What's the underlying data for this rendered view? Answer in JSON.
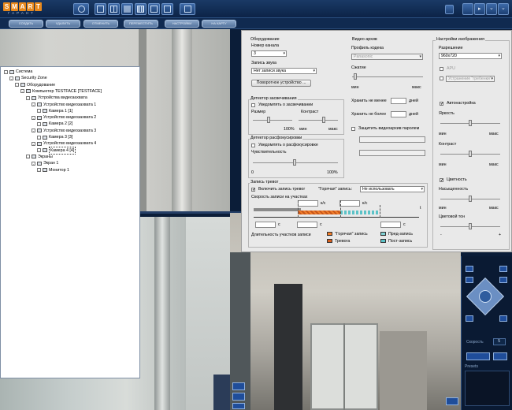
{
  "logo": {
    "word": "SMART",
    "sub": "ГАРАНТ"
  },
  "commands": [
    "создать",
    "удалить",
    "отменить",
    "переместить",
    "настройки",
    "на карту"
  ],
  "tree": {
    "items": [
      {
        "label": "Система",
        "level": 0,
        "icon": "system-icon"
      },
      {
        "label": "Security Zone",
        "level": 1,
        "icon": "zone-icon"
      },
      {
        "label": "Оборудование",
        "level": 2,
        "icon": "folder-icon"
      },
      {
        "label": "Компьютер TESTFACE [TESTFACE]",
        "level": 3,
        "icon": "computer-icon"
      },
      {
        "label": "Устройства видеозахвата",
        "level": 4,
        "icon": "folder-icon"
      },
      {
        "label": "Устройство видеозахвата 1",
        "level": 5,
        "icon": "capture-device-icon"
      },
      {
        "label": "Камера 1 [1]",
        "level": 6,
        "icon": "camera-icon"
      },
      {
        "label": "Устройство видеозахвата 2",
        "level": 5,
        "icon": "capture-device-icon"
      },
      {
        "label": "Камера 2 [2]",
        "level": 6,
        "icon": "camera-icon"
      },
      {
        "label": "Устройство видеозахвата 3",
        "level": 5,
        "icon": "capture-device-icon"
      },
      {
        "label": "Камера 3 [3]",
        "level": 6,
        "icon": "camera-icon"
      },
      {
        "label": "Устройство видеозахвата 4",
        "level": 5,
        "icon": "capture-device-icon"
      },
      {
        "label": "Камера 4 [4]",
        "level": 6,
        "icon": "camera-icon",
        "selected": true
      },
      {
        "label": "Экраны",
        "level": 4,
        "icon": "folder-icon"
      },
      {
        "label": "Экран 1",
        "level": 5,
        "icon": "screen-icon"
      },
      {
        "label": "Монитор 1",
        "level": 6,
        "icon": "monitor-icon"
      }
    ]
  },
  "equipment": {
    "title": "Оборудование",
    "channel_label": "Номер канала",
    "channel_value": "3",
    "audio_label": "Запись звука",
    "audio_value": "Нет записи звука",
    "rotate_button": "Поворотное устройство ..."
  },
  "archive": {
    "title": "Видео архив",
    "codec_label": "Профиль кодека",
    "codec_value": "Panasonic",
    "compression_label": "Сжатие",
    "min": "мин",
    "max": "макс",
    "keep_min_label": "Хранить не менее",
    "keep_max_label": "Хранить не более",
    "days": "дней",
    "protect_label": "Защитить видеоархив паролем"
  },
  "image": {
    "title": "Настройки изображения",
    "resolution_label": "Разрешение",
    "resolution_value": "960x720",
    "fps_label": "APU",
    "deinterlace_value": "Устранение \"гребенки\"",
    "autotune_label": "Автонастройка",
    "brightness_label": "Яркость",
    "contrast_label": "Контраст",
    "color_label": "Цветность",
    "saturation_label": "Насыщенность",
    "hue_label": "Цветовой тон",
    "min": "мин",
    "max": "макс",
    "minus": "-",
    "plus": "+"
  },
  "glare": {
    "title": "Детектор засвечивания",
    "notify_label": "Уведомлять о засвечивании",
    "size_label": "Размер",
    "contrast_label": "Контраст",
    "pct100": "100%",
    "min": "мин",
    "max": "макс"
  },
  "defocus": {
    "title": "Детектор расфокусировки",
    "notify_label": "Уведомлять о расфокусировке",
    "sensitivity_label": "Чувствительность",
    "zero": "0",
    "pct100": "100%"
  },
  "alarm": {
    "title": "Запись тревог",
    "enable_label": "Включить запись тревог",
    "hot_label": "\"Горячая\" запись:",
    "hot_value": "Не использовать",
    "speed_label": "Скорость записи на участках",
    "kps": "к/с",
    "t": "t",
    "c": "с",
    "duration_label": "Длительность участков записи",
    "legend_hot": "\"Горячая\" запись",
    "legend_alarm": "Тревога",
    "legend_pre": "Пред-запись",
    "legend_post": "Пост-запись"
  },
  "ptz": {
    "speed_label": "Скорость",
    "speed_value": "5",
    "presets_label": "Presets"
  },
  "colors": {
    "hot": "#f07d2a",
    "alarm": "#d9601e",
    "pre": "#7fd0d3",
    "post": "#5cc3c8",
    "accent": "#1c3f73"
  }
}
